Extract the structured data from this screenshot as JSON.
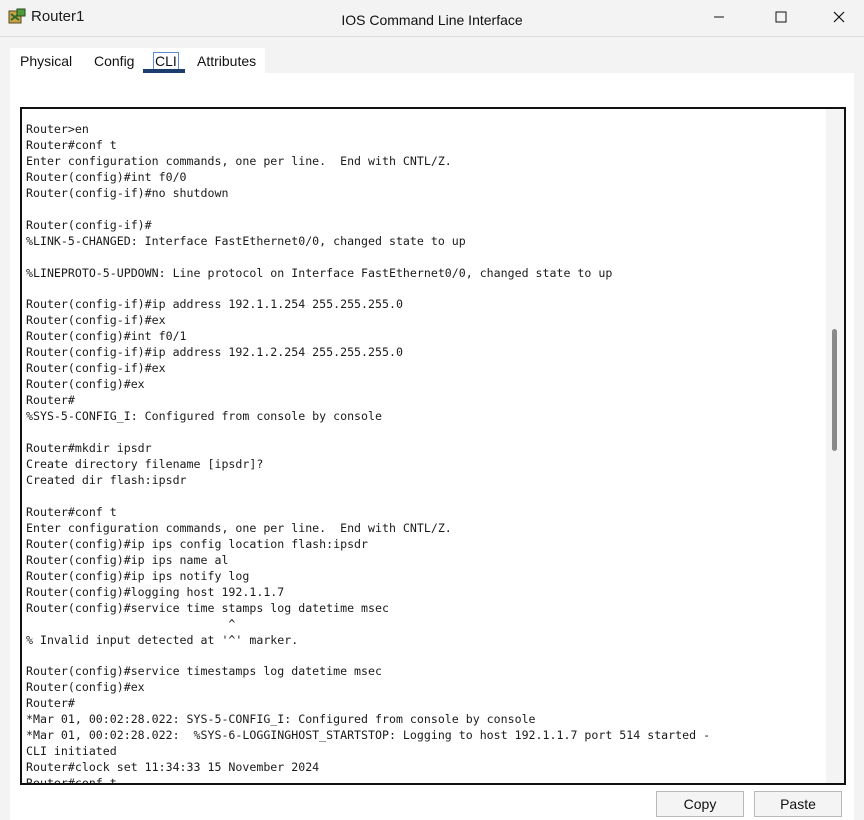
{
  "window": {
    "title": "Router1",
    "icons": {
      "app": "router-app-icon",
      "minimize": "minimize-icon",
      "maximize": "maximize-icon",
      "close": "close-icon"
    }
  },
  "tabs": [
    {
      "label": "Physical",
      "active": false
    },
    {
      "label": "Config",
      "active": false
    },
    {
      "label": "CLI",
      "active": true
    },
    {
      "label": "Attributes",
      "active": false
    }
  ],
  "panel": {
    "title": "IOS Command Line Interface"
  },
  "terminal": {
    "lines": [
      "Router>en",
      "Router#conf t",
      "Enter configuration commands, one per line.  End with CNTL/Z.",
      "Router(config)#int f0/0",
      "Router(config-if)#no shutdown",
      "",
      "Router(config-if)#",
      "%LINK-5-CHANGED: Interface FastEthernet0/0, changed state to up",
      "",
      "%LINEPROTO-5-UPDOWN: Line protocol on Interface FastEthernet0/0, changed state to up",
      "",
      "Router(config-if)#ip address 192.1.1.254 255.255.255.0",
      "Router(config-if)#ex",
      "Router(config)#int f0/1",
      "Router(config-if)#ip address 192.1.2.254 255.255.255.0",
      "Router(config-if)#ex",
      "Router(config)#ex",
      "Router#",
      "%SYS-5-CONFIG_I: Configured from console by console",
      "",
      "Router#mkdir ipsdr",
      "Create directory filename [ipsdr]?",
      "Created dir flash:ipsdr",
      "",
      "Router#conf t",
      "Enter configuration commands, one per line.  End with CNTL/Z.",
      "Router(config)#ip ips config location flash:ipsdr",
      "Router(config)#ip ips name al",
      "Router(config)#ip ips notify log",
      "Router(config)#logging host 192.1.1.7",
      "Router(config)#service time stamps log datetime msec",
      "                             ^",
      "% Invalid input detected at '^' marker.",
      "",
      "Router(config)#service timestamps log datetime msec",
      "Router(config)#ex",
      "Router#",
      "*Mar 01, 00:02:28.022: SYS-5-CONFIG_I: Configured from console by console",
      "*Mar 01, 00:02:28.022:  %SYS-6-LOGGINGHOST_STARTSTOP: Logging to host 192.1.1.7 port 514 started -",
      "CLI initiated",
      "Router#clock set 11:34:33 15 November 2024",
      "Router#conf t"
    ]
  },
  "buttons": {
    "copy": "Copy",
    "paste": "Paste"
  }
}
